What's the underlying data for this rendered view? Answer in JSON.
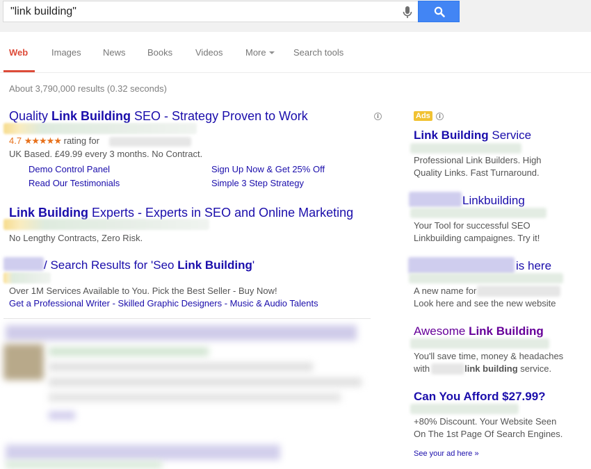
{
  "search": {
    "query": "\"link building\""
  },
  "tabs": [
    {
      "label": "Web"
    },
    {
      "label": "Images"
    },
    {
      "label": "News"
    },
    {
      "label": "Books"
    },
    {
      "label": "Videos"
    },
    {
      "label": "More"
    },
    {
      "label": "Search tools"
    }
  ],
  "stats": "About 3,790,000 results (0.32 seconds)",
  "left_ads": [
    {
      "title_pre": "Quality ",
      "title_bold": "Link Building",
      "title_post": " SEO - Strategy Proven to Work",
      "rating_value": "4.7",
      "rating_stars": "★★★★★",
      "rating_text": "rating for",
      "desc": "UK Based. £49.99 every 3 months. No Contract.",
      "sitelinks": [
        "Demo Control Panel",
        "Sign Up Now & Get 25% Off",
        "Read Our Testimonials",
        "Simple 3 Step Strategy"
      ]
    },
    {
      "title_bold": "Link Building",
      "title_post": " Experts - Experts in SEO and Online Marketing",
      "desc": "No Lengthy Contracts, Zero Risk."
    },
    {
      "title_pre": " / Search Results for 'Seo ",
      "title_bold": "Link Building",
      "title_post": "'",
      "desc": "Over 1M Services Available to You. Pick the Best Seller - Buy Now!",
      "sitelinks_line": "Get a Professional Writer - Skilled Graphic Designers - Music & Audio Talents"
    }
  ],
  "right_ads": {
    "badge": "Ads",
    "items": [
      {
        "title_bold": "Link Building",
        "title_post": " Service",
        "desc1": "Professional Link Builders. High",
        "desc2": "Quality Links. Fast Turnaround."
      },
      {
        "title_post": "Linkbuilding",
        "desc1": "Your Tool for successful SEO",
        "desc2": "Linkbuilding campaignes. Try it!"
      },
      {
        "title_post": "is here",
        "desc1": "A new name for",
        "desc2": "Look here and see the new website"
      },
      {
        "title_pre": "Awesome ",
        "title_bold": "Link Building",
        "desc1": "You'll save time, money & headaches",
        "desc2_pre": "with",
        "desc2_bold": "link building",
        "desc2_post": " service."
      },
      {
        "title_post": "Can You Afford $27.99?",
        "desc1": "+80% Discount. Your Website Seen",
        "desc2": "On The 1st Page Of Search Engines."
      }
    ],
    "see_ad": "See your ad here »"
  },
  "colors": {
    "link": "#1a0dab",
    "visited": "#660099",
    "accent_red": "#dd4b39",
    "search_blue": "#4285f4",
    "ads_badge": "#f1c232",
    "rating_orange": "#e7711b"
  },
  "icons": [
    "microphone-icon",
    "search-icon",
    "info-icon",
    "caret-down-icon"
  ]
}
